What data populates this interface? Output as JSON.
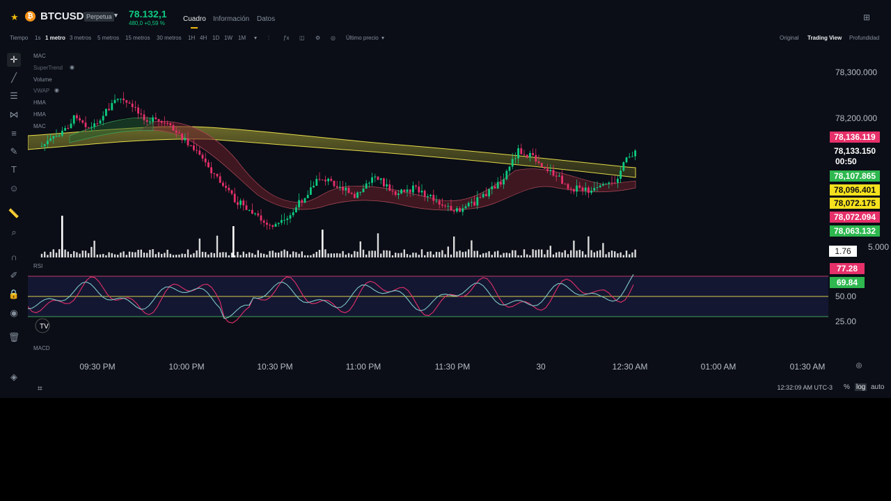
{
  "header": {
    "symbol": "BTCUSDT",
    "contract_badge": "Perpetua",
    "price": "78.132,1",
    "change": "480,0 +0,59 %",
    "tabs": [
      "Cuadro",
      "Información",
      "Datos"
    ],
    "active_tab": "Cuadro"
  },
  "toolbar": {
    "time_label": "Tiempo",
    "intervals": [
      "1s",
      "1 metro",
      "3 metros",
      "5 metros",
      "15 metros",
      "30 metros",
      "1H",
      "4H",
      "1D",
      "1W",
      "1M"
    ],
    "active_interval": "1 metro",
    "price_source": "Último precio",
    "views": [
      "Original",
      "Trading View",
      "Profundidad"
    ],
    "active_view": "Trading View"
  },
  "legend": {
    "items": [
      "MAC",
      "SuperTrend",
      "Volume",
      "VWAP",
      "HMA",
      "HMA",
      "MAC"
    ]
  },
  "panes": {
    "rsi_label": "RSI",
    "macd_label": "MACD"
  },
  "price_axis": {
    "labels": [
      "78,300.000",
      "78,200.000",
      "5.000"
    ],
    "rsi_labels": [
      "50.00",
      "25.00"
    ],
    "tags": [
      {
        "text": "78,136.119",
        "color": "#e6306a"
      },
      {
        "text": "78,133.150",
        "color": "#0b0e16"
      },
      {
        "text": "00:50",
        "color": "#0b0e16"
      },
      {
        "text": "78,107.865",
        "color": "#2eb84f"
      },
      {
        "text": "78,096.401",
        "color": "#f5e11d"
      },
      {
        "text": "78,072.175",
        "color": "#f5e11d"
      },
      {
        "text": "78,072.094",
        "color": "#e6306a"
      },
      {
        "text": "78,063.132",
        "color": "#2eb84f"
      }
    ],
    "volume_tag": "1.76",
    "rsi_tags": [
      {
        "text": "77.28",
        "color": "#e6306a"
      },
      {
        "text": "69.84",
        "color": "#2eb84f"
      }
    ]
  },
  "time_axis": [
    "09:30 PM",
    "10:00 PM",
    "10:30 PM",
    "11:00 PM",
    "11:30 PM",
    "30",
    "12:30 AM",
    "01:00 AM",
    "01:30 AM"
  ],
  "footer": {
    "clock": "12:32:09 AM UTC-3",
    "options": [
      "%",
      "log",
      "auto"
    ],
    "active_option": "log"
  },
  "colors": {
    "up": "#0ecb81",
    "down": "#e6306a",
    "accent": "#f0b90b",
    "ma_band": "#d9d24a"
  }
}
